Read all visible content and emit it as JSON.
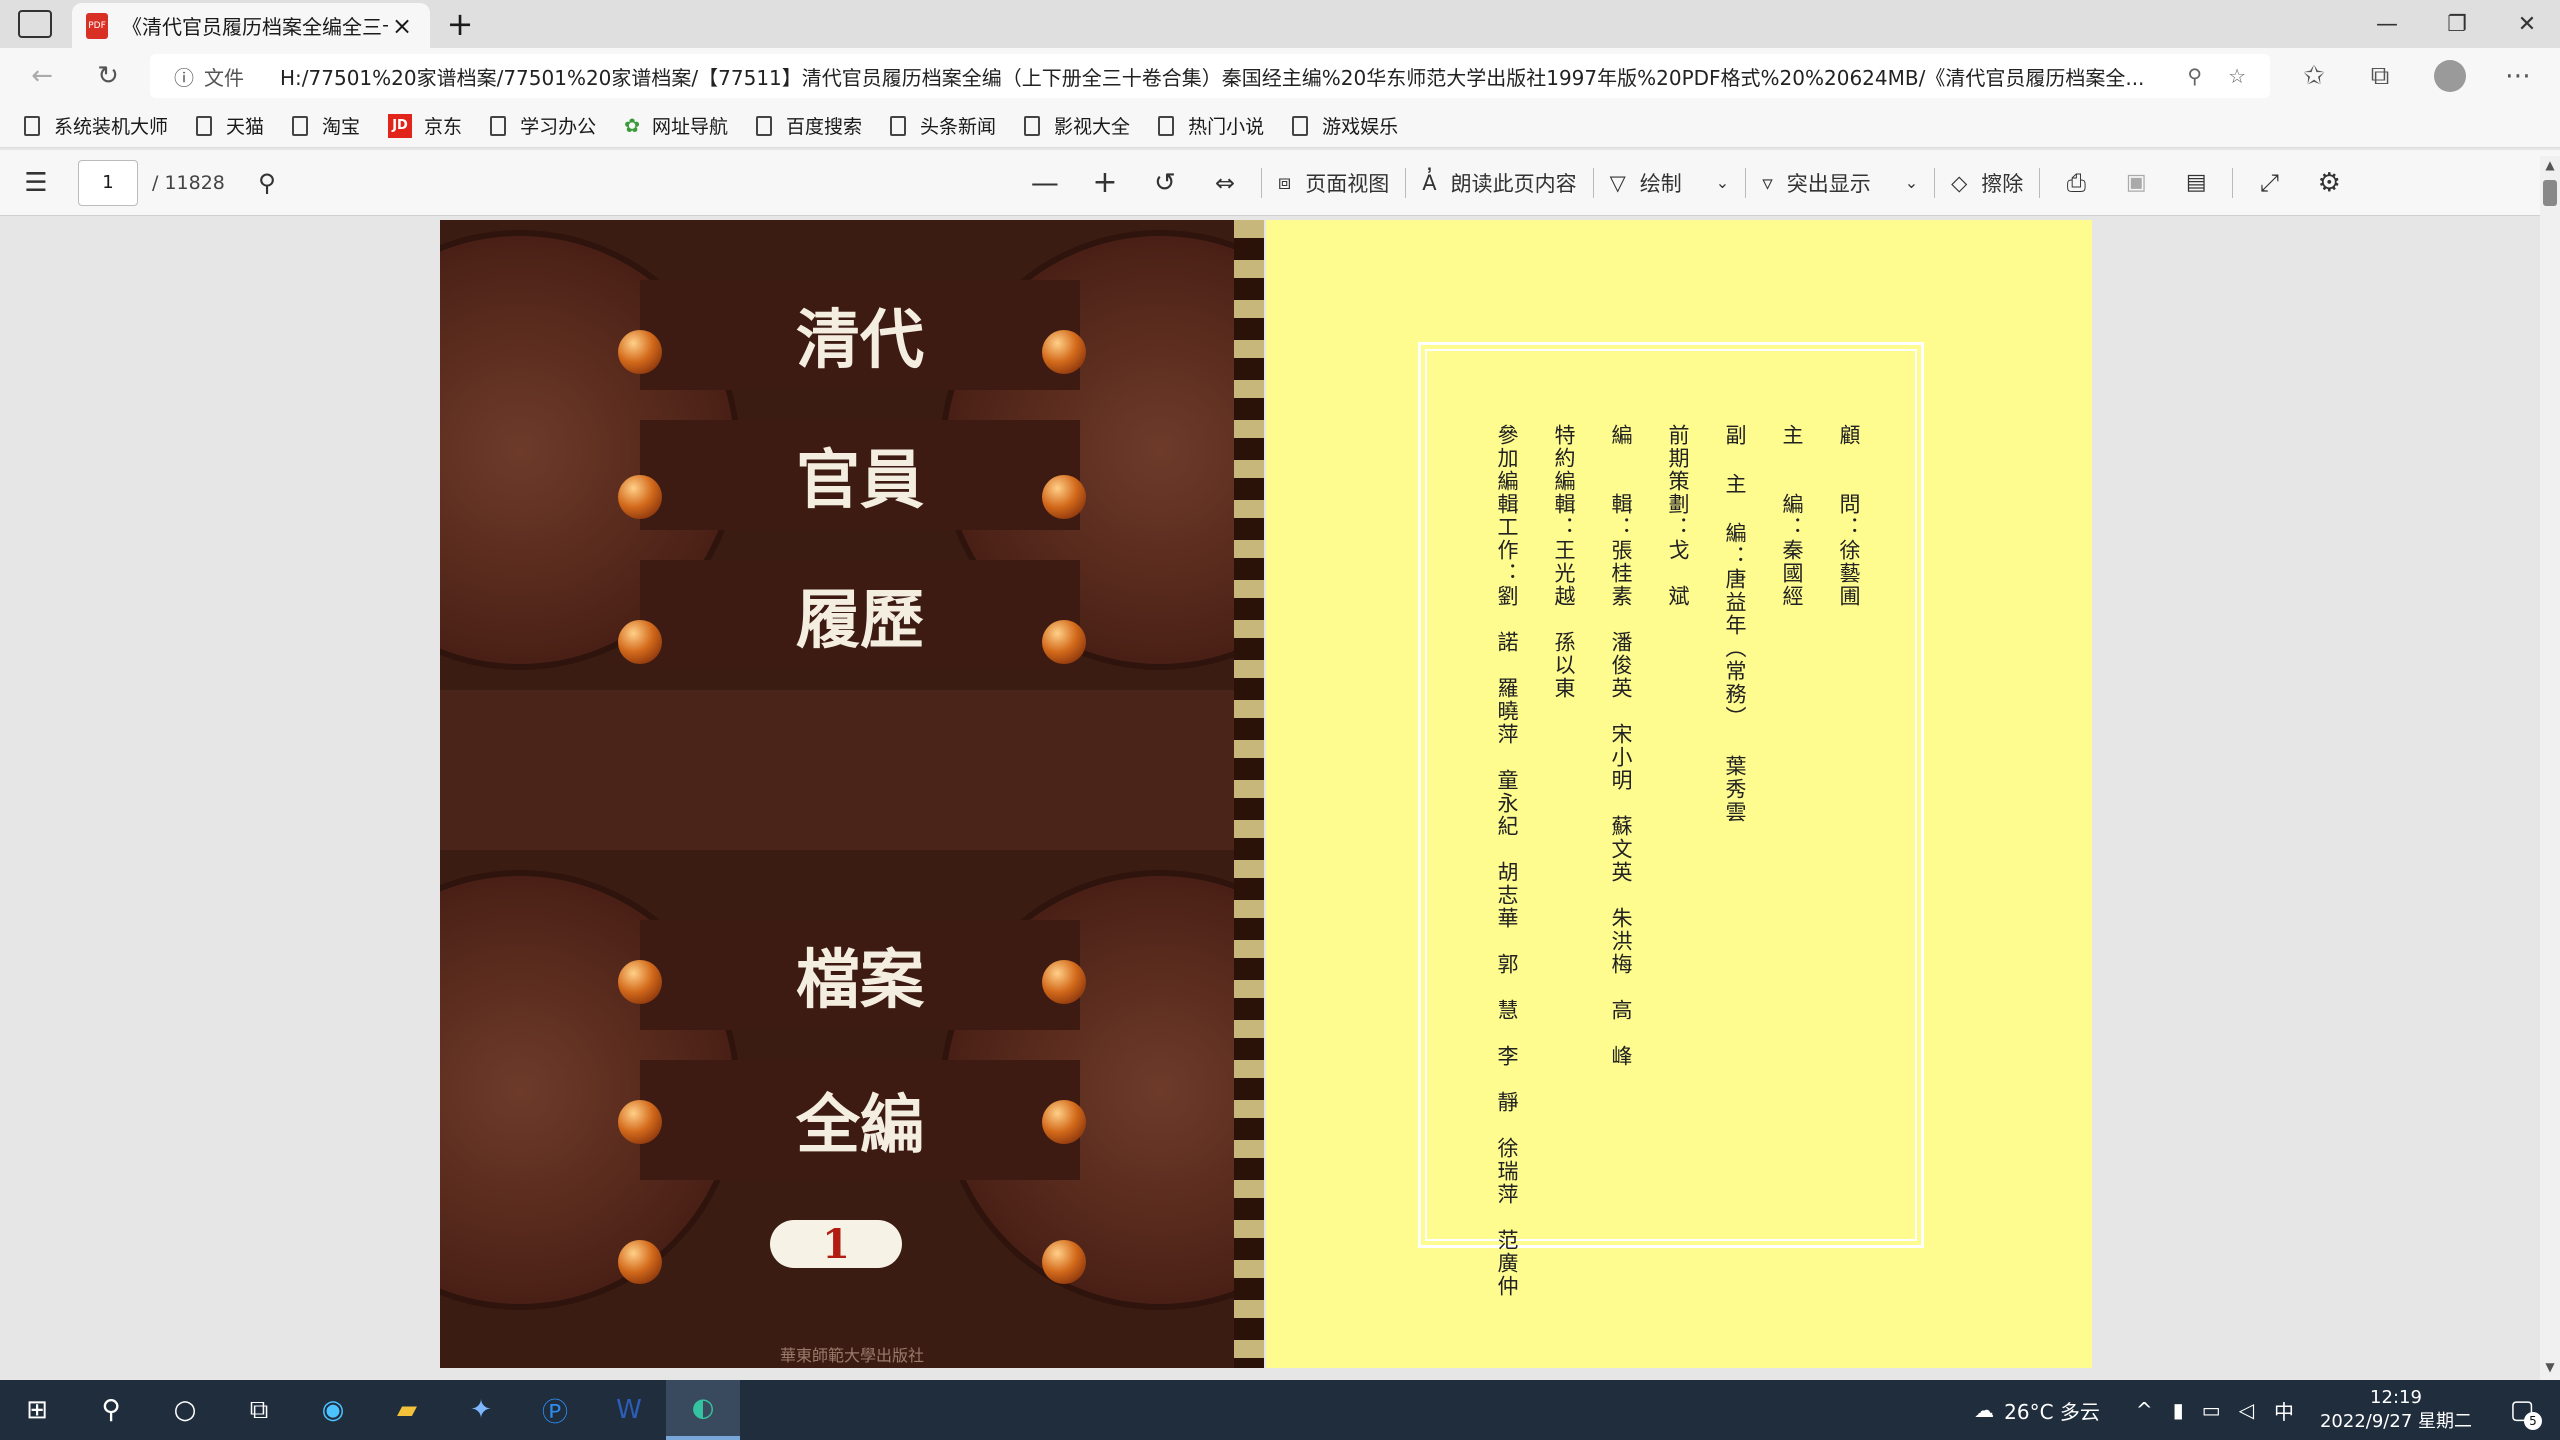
{
  "browser": {
    "tab_title": "《清代官员履历档案全编全三十",
    "url_info": "ⓘ",
    "url_file": "文件",
    "url": "H:/77501%20家谱档案/77501%20家谱档案/【77511】清代官员履历档案全编（上下册全三十卷合集）秦国经主编%20华东师范大学出版社1997年版%20PDF格式%20%20624MB/《清代官员履历档案全..."
  },
  "bookmarks": [
    {
      "label": "系统装机大师"
    },
    {
      "label": "天猫"
    },
    {
      "label": "淘宝"
    },
    {
      "label": "京东"
    },
    {
      "label": "学习办公"
    },
    {
      "label": "网址导航"
    },
    {
      "label": "百度搜索"
    },
    {
      "label": "头条新闻"
    },
    {
      "label": "影视大全"
    },
    {
      "label": "热门小说"
    },
    {
      "label": "游戏娱乐"
    }
  ],
  "pdf_toolbar": {
    "page_current": "1",
    "page_total": "/ 11828",
    "page_view": "页面视图",
    "read_aloud": "朗读此页内容",
    "draw": "绘制",
    "highlight": "突出显示",
    "erase": "擦除"
  },
  "cover": {
    "line1": "清代",
    "line2": "官員",
    "line3": "履歷",
    "line4": "檔案",
    "line5": "全編",
    "volume": "1",
    "publisher": "華東師範大學出版社"
  },
  "credits": {
    "columns": [
      "顧　　問：徐藝圃",
      "主　　編：秦國經",
      "副 主 編：唐益年（常務） 葉秀雲",
      "前期策劃：戈　斌",
      "編　　輯：張桂素　潘俊英　宋小明　蘇文英　朱洪梅　高　峰",
      "特約編輯：王光越　孫以東",
      "參加編輯工作：劉　諾　羅曉萍　童永紀　胡志華　郭　慧　李　靜　徐瑞萍　范廣仲"
    ]
  },
  "taskbar": {
    "weather": "26°C 多云",
    "ime": "中",
    "time": "12:19",
    "date": "2022/9/27 星期二",
    "notifications": "5"
  }
}
